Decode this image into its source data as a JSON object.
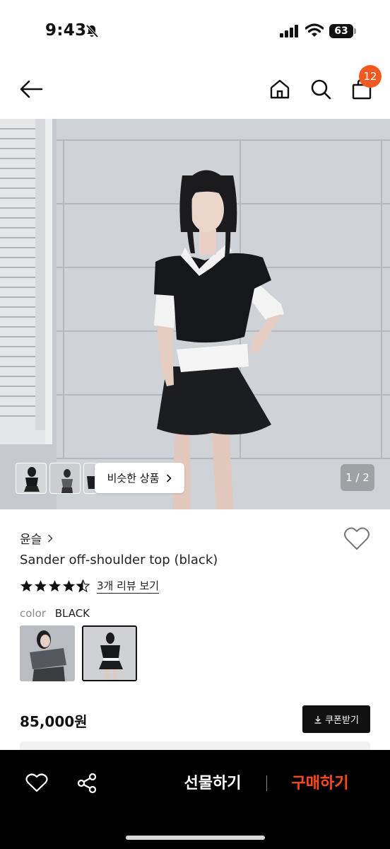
{
  "status_bar": {
    "time": "9:43",
    "battery": "63"
  },
  "nav": {
    "cart_badge": "12"
  },
  "hero": {
    "similar_label": "비슷한 상품",
    "page_indicator": "1 / 2"
  },
  "product": {
    "brand": "윤슬",
    "title": "Sander off-shoulder top (black)",
    "rating": 4.5,
    "review_link": "3개 리뷰 보기",
    "color_key": "color",
    "color_value": "BLACK",
    "price": "85,000원",
    "coupon_label": "쿠폰받기"
  },
  "bottom_bar": {
    "gift_label": "선물하기",
    "buy_label": "구매하기"
  },
  "colors": {
    "accent": "#f05a22",
    "buy": "#ff4b18",
    "bar": "#000000"
  },
  "icons": {
    "back": "arrow-left-icon",
    "home": "home-icon",
    "search": "search-icon",
    "cart": "shopping-bag-icon",
    "wish": "heart-icon",
    "share": "share-icon",
    "coupon": "download-icon"
  }
}
